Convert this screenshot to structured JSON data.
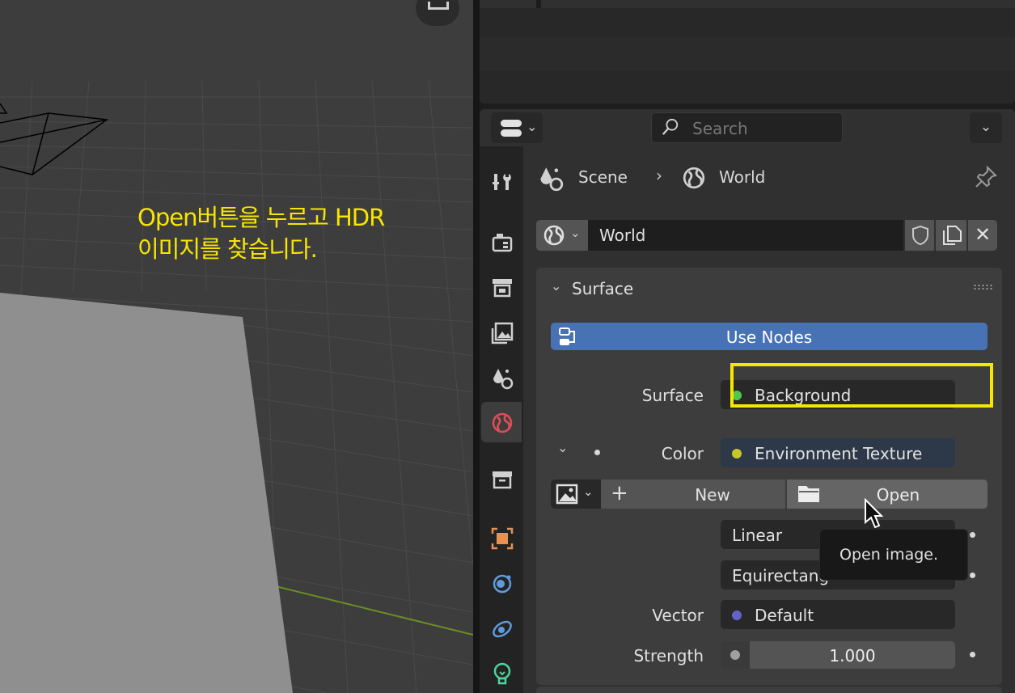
{
  "annotation": {
    "line1": "Open버튼을 누르고 HDR",
    "line2": "이미지를 찾습니다."
  },
  "header": {
    "search_placeholder": "Search",
    "options_chevron": "⌄",
    "editor_chevron": "⌄"
  },
  "breadcrumb": {
    "scene": "Scene",
    "separator": "›",
    "world": "World"
  },
  "world_selector": {
    "name": "World",
    "unlink_symbol": "✕"
  },
  "surface_panel": {
    "title": "Surface",
    "use_nodes_label": "Use Nodes",
    "surface_label": "Surface",
    "surface_value": "Background",
    "color_label": "Color",
    "color_value": "Environment Texture",
    "new_label": "New",
    "plus_symbol": "+",
    "open_label": "Open",
    "interpolation_value": "Linear",
    "projection_value": "Equirectang",
    "vector_label": "Vector",
    "vector_value": "Default",
    "strength_label": "Strength",
    "strength_value": "1.000"
  },
  "tooltip": {
    "text": "Open image."
  },
  "colors": {
    "accent_blue": "#4772b3",
    "annotation_yellow": "#f7e600",
    "socket_green": "#4ec94e",
    "socket_yellow": "#c7c729",
    "socket_purple": "#6363c7",
    "world_tab_red": "#e04d57"
  },
  "tabs": [
    {
      "icon": "tool-icon",
      "active": false
    },
    {
      "icon": "render-icon",
      "active": false
    },
    {
      "icon": "output-icon",
      "active": false
    },
    {
      "icon": "view-layer-icon",
      "active": false
    },
    {
      "icon": "scene-icon",
      "active": false
    },
    {
      "icon": "world-icon",
      "active": true
    },
    {
      "icon": "collection-icon",
      "active": false
    },
    {
      "icon": "object-icon",
      "active": false
    },
    {
      "icon": "modifier-icon",
      "active": false
    },
    {
      "icon": "physics-icon",
      "active": false
    },
    {
      "icon": "object-data-light-icon",
      "active": false
    }
  ]
}
